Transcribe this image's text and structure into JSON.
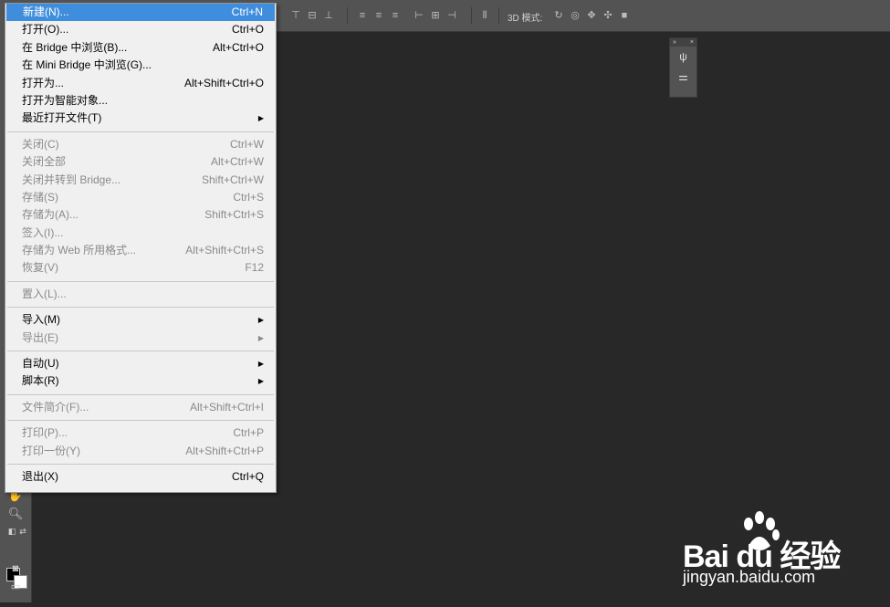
{
  "options_bar": {
    "mode_label": "3D 模式:"
  },
  "file_menu": {
    "items": [
      {
        "label": "新建(N)...",
        "shortcut": "Ctrl+N"
      },
      {
        "label": "打开(O)...",
        "shortcut": "Ctrl+O"
      },
      {
        "label": "在 Bridge 中浏览(B)...",
        "shortcut": "Alt+Ctrl+O"
      },
      {
        "label": "在 Mini Bridge 中浏览(G)...",
        "shortcut": ""
      },
      {
        "label": "打开为...",
        "shortcut": "Alt+Shift+Ctrl+O"
      },
      {
        "label": "打开为智能对象...",
        "shortcut": ""
      },
      {
        "label": "最近打开文件(T)",
        "shortcut": ""
      },
      {
        "label": "关闭(C)",
        "shortcut": "Ctrl+W"
      },
      {
        "label": "关闭全部",
        "shortcut": "Alt+Ctrl+W"
      },
      {
        "label": "关闭并转到 Bridge...",
        "shortcut": "Shift+Ctrl+W"
      },
      {
        "label": "存储(S)",
        "shortcut": "Ctrl+S"
      },
      {
        "label": "存储为(A)...",
        "shortcut": "Shift+Ctrl+S"
      },
      {
        "label": "签入(I)...",
        "shortcut": ""
      },
      {
        "label": "存储为 Web 所用格式...",
        "shortcut": "Alt+Shift+Ctrl+S"
      },
      {
        "label": "恢复(V)",
        "shortcut": "F12"
      },
      {
        "label": "置入(L)...",
        "shortcut": ""
      },
      {
        "label": "导入(M)",
        "shortcut": ""
      },
      {
        "label": "导出(E)",
        "shortcut": ""
      },
      {
        "label": "自动(U)",
        "shortcut": ""
      },
      {
        "label": "脚本(R)",
        "shortcut": ""
      },
      {
        "label": "文件简介(F)...",
        "shortcut": "Alt+Shift+Ctrl+I"
      },
      {
        "label": "打印(P)...",
        "shortcut": "Ctrl+P"
      },
      {
        "label": "打印一份(Y)",
        "shortcut": "Alt+Shift+Ctrl+P"
      },
      {
        "label": "退出(X)",
        "shortcut": "Ctrl+Q"
      }
    ]
  },
  "watermark": {
    "brand": "Bai du 经验",
    "url": "jingyan.baidu.com"
  },
  "colors": {
    "highlight": "#3f8ddd",
    "menu_bg": "#f0f0f0",
    "canvas_bg": "#282828",
    "ui_panel": "#535353"
  }
}
